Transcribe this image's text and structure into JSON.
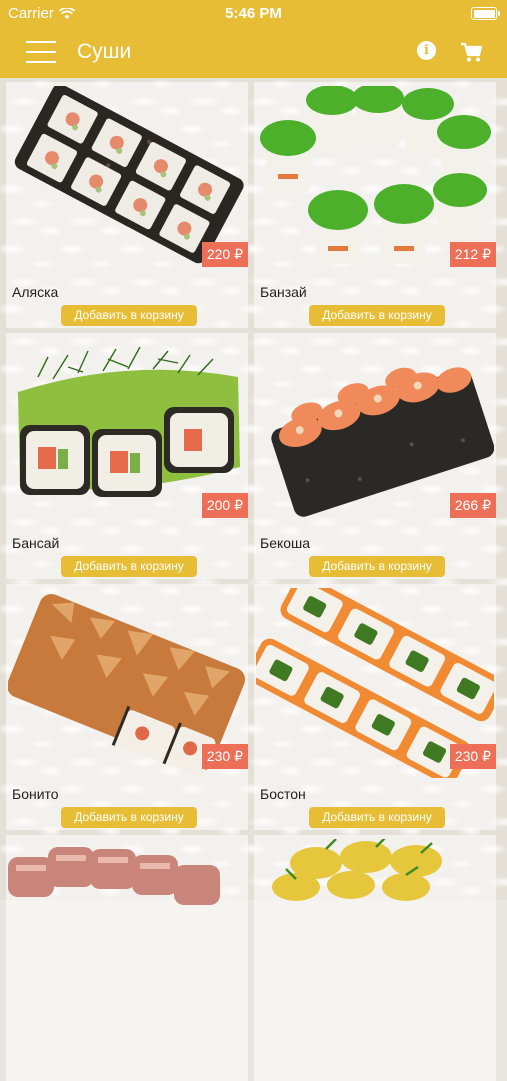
{
  "status_bar": {
    "carrier": "Carrier",
    "time": "5:46 PM"
  },
  "nav": {
    "title": "Суши",
    "menu_icon": "hamburger-menu-icon",
    "info_icon": "info-icon",
    "cart_icon": "cart-icon"
  },
  "colors": {
    "accent": "#e8bd36",
    "price_badge": "#ee6f58",
    "header_text": "#ffffff"
  },
  "products": [
    {
      "name": "Аляска",
      "price": "220 ₽",
      "add_label": "Добавить в корзину"
    },
    {
      "name": "Банзай",
      "price": "212 ₽",
      "add_label": "Добавить в корзину"
    },
    {
      "name": "Бансай",
      "price": "200 ₽",
      "add_label": "Добавить в корзину"
    },
    {
      "name": "Бекоша",
      "price": "266 ₽",
      "add_label": "Добавить в корзину"
    },
    {
      "name": "Бонито",
      "price": "230 ₽",
      "add_label": "Добавить в корзину"
    },
    {
      "name": "Бостон",
      "price": "230 ₽",
      "add_label": "Добавить в корзину"
    },
    {
      "name": "",
      "price": "",
      "add_label": ""
    },
    {
      "name": "",
      "price": "",
      "add_label": ""
    }
  ]
}
